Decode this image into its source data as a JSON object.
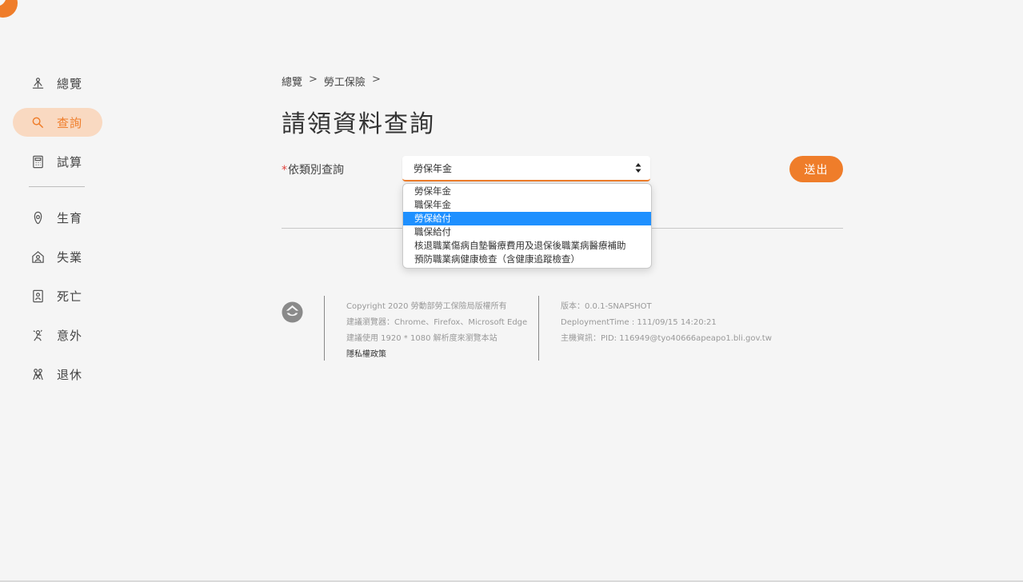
{
  "sidebar": {
    "items": [
      {
        "label": "總覽",
        "icon": "overview-icon"
      },
      {
        "label": "查詢",
        "icon": "search-icon",
        "active": true
      },
      {
        "label": "試算",
        "icon": "calculator-icon"
      },
      {
        "label": "生育",
        "icon": "birth-icon"
      },
      {
        "label": "失業",
        "icon": "unemployment-icon"
      },
      {
        "label": "死亡",
        "icon": "death-icon"
      },
      {
        "label": "意外",
        "icon": "accident-icon"
      },
      {
        "label": "退休",
        "icon": "retirement-icon"
      }
    ]
  },
  "breadcrumb": {
    "items": [
      "總覽",
      "勞工保險"
    ],
    "separator": ">"
  },
  "page": {
    "title": "請領資料查詢"
  },
  "form": {
    "required_mark": "*",
    "category_label": "依類別查詢",
    "selected_value": "勞保年金",
    "submit_label": "送出"
  },
  "dropdown": {
    "options": [
      "勞保年金",
      "職保年金",
      "勞保給付",
      "職保給付",
      "核退職業傷病自墊醫療費用及退保後職業病醫療補助",
      "預防職業病健康檢查（含健康追蹤檢查）"
    ],
    "highlighted": "勞保給付"
  },
  "footer": {
    "copyright": "Copyright 2020 勞動部勞工保險局版權所有",
    "browsers": "建議瀏覽器：Chrome、Firefox、Microsoft Edge",
    "resolution": "建議使用 1920 * 1080 解析度來瀏覽本站",
    "privacy": "隱私權政策",
    "version": "版本：0.0.1-SNAPSHOT",
    "deployment": "DeploymentTime : 111/09/15 14:20:21",
    "host": "主機資訊：PID: 116949@tyo40666apeapo1.bli.gov.tw"
  },
  "colors": {
    "accent": "#ef7d2a",
    "accent_light": "#f9d9c1",
    "highlight": "#1e90ff",
    "background": "#f5f5f5"
  }
}
